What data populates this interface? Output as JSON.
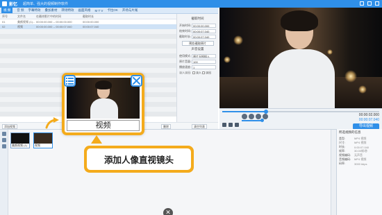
{
  "titlebar": {
    "app": "影忆",
    "subtitle": "超简单、强大的视频制作软件"
  },
  "menubar": {
    "items": [
      "视 频",
      "音 频",
      "字幕特效",
      "叠加素材",
      "转场特效",
      "画面风格",
      "M T V",
      "卡拉OK",
      "开场与片尾"
    ]
  },
  "list": {
    "headers": [
      "序号",
      "文件名",
      "在最终影片中的时间",
      "截取时长"
    ],
    "rows": [
      {
        "num": "01",
        "name": "美颜视频 (1)...",
        "time": "00:00:00.000 -- 00:00:00.000",
        "duration": "00:00:00.000"
      },
      {
        "num": "02",
        "name": "视频",
        "time": "00:00:00.000 -- 00:00:07.040",
        "duration": "00:00:07.040"
      }
    ]
  },
  "settings": {
    "title": "截取时间",
    "start_label": "开始时间:",
    "start_value": "00:00:00.000",
    "end_label": "结束时间:",
    "end_value": "00:00:07.040",
    "length_label": "截取时长:",
    "length_value": "00:00:07.040",
    "preview_btn": "预览/截取原片",
    "sound_title": "声音设置",
    "mode_label": "使用模式:",
    "mode_value": "原片无损插入",
    "volume_label": "原片音量:",
    "volume_value": "100",
    "speed_label": "播放速度:",
    "speed_value": "1",
    "fade_label": "淡入淡出:",
    "fade_in": "淡入",
    "fade_out": "淡出"
  },
  "player": {
    "time_current": "00:00:02.000",
    "time_total": "00:00:07.040",
    "progress": 0.28
  },
  "buttons": {
    "add_video": "添加视频",
    "delete": "删除",
    "clear_list": "清空列表"
  },
  "export_btn": "导出视频",
  "timeline": {
    "clips": [
      {
        "caption": "美颜视频 (1)"
      },
      {
        "caption": "视频"
      }
    ]
  },
  "info": {
    "title": "所选视频的信息",
    "rows": [
      {
        "k": "类型:",
        "v": "MP4 视频"
      },
      {
        "k": "尺寸:",
        "v": "MP4 视频"
      },
      {
        "k": "时长:",
        "v": "0:00:07.040"
      },
      {
        "k": "帧率:",
        "v": "30.00帧/秒"
      },
      {
        "k": "视频编码:",
        "v": "无声音"
      },
      {
        "k": "音频编码:",
        "v": "MP4 视频"
      },
      {
        "k": "码率:",
        "v": "3000 kbps"
      }
    ]
  },
  "popup": {
    "label": "视频"
  },
  "callout": {
    "text": "添加人像直视镜头"
  },
  "colors": {
    "accent": "#2f8fe8",
    "highlight": "#f4ab1c"
  }
}
